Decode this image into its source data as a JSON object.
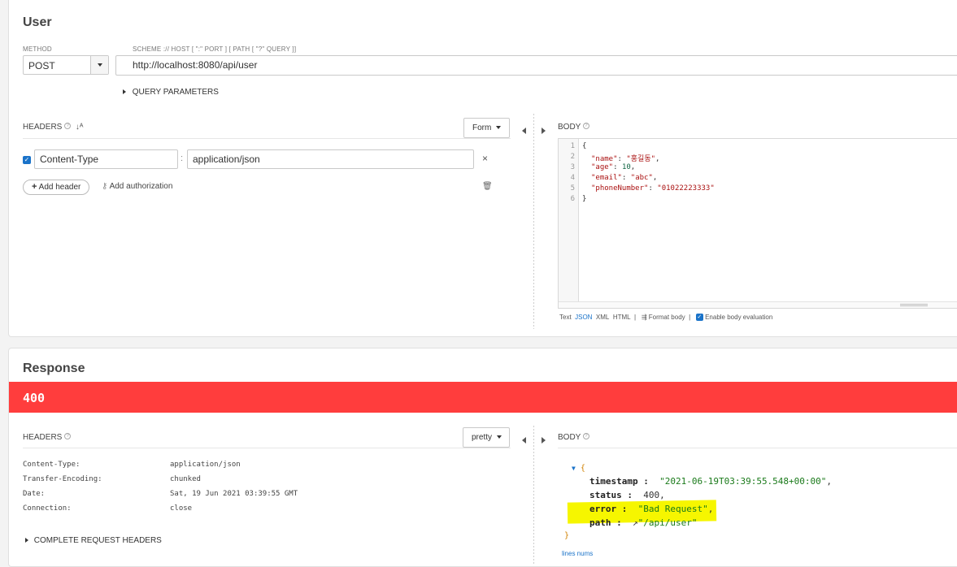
{
  "request": {
    "title": "User",
    "method_label": "METHOD",
    "method_value": "POST",
    "url_label": "SCHEME :// HOST [ \":\" PORT ] [ PATH [ \"?\" QUERY ]]",
    "url_value": "http://localhost:8080/api/user",
    "query_params_label": "QUERY PARAMETERS",
    "headers_label": "HEADERS",
    "headers_mode": "Form",
    "header_rows": [
      {
        "enabled": true,
        "name": "Content-Type",
        "value": "application/json"
      }
    ],
    "add_header_label": "Add header",
    "add_auth_label": "Add authorization",
    "body_label": "BODY",
    "body_lines": [
      {
        "num": "1",
        "text": "{"
      },
      {
        "num": "2",
        "key": "\"name\"",
        "value": "\"홍길동\"",
        "tail": ","
      },
      {
        "num": "3",
        "key": "\"age\"",
        "value": "10",
        "tail": ","
      },
      {
        "num": "4",
        "key": "\"email\"",
        "value": "\"abc\"",
        "tail": ","
      },
      {
        "num": "5",
        "key": "\"phoneNumber\"",
        "value": "\"01022223333\"",
        "tail": ""
      },
      {
        "num": "6",
        "text": "}"
      }
    ],
    "body_formats": {
      "text": "Text",
      "json": "JSON",
      "xml": "XML",
      "html": "HTML"
    },
    "format_body_label": "Format body",
    "enable_eval_label": "Enable body evaluation",
    "enable_eval_checked": true
  },
  "response": {
    "title": "Response",
    "status_code": "400",
    "status_color": "#ff3d3d",
    "headers_label": "HEADERS",
    "headers_mode": "pretty",
    "headers": [
      {
        "key": "Content-Type:",
        "value": "application/json"
      },
      {
        "key": "Transfer-Encoding:",
        "value": "chunked"
      },
      {
        "key": "Date:",
        "value": "Sat, 19 Jun 2021 03:39:55 GMT"
      },
      {
        "key": "Connection:",
        "value": "close"
      }
    ],
    "complete_headers_label": "COMPLETE REQUEST HEADERS",
    "body_label": "BODY",
    "body": {
      "timestamp_key": "timestamp",
      "timestamp_value": "\"2021-06-19T03:39:55.548+00:00\"",
      "status_key": "status",
      "status_value": "400",
      "error_key": "error",
      "error_value": "\"Bad Request\"",
      "path_key": "path",
      "path_value": "\"/api/user\""
    },
    "lines_nums_label": "lines nums"
  }
}
